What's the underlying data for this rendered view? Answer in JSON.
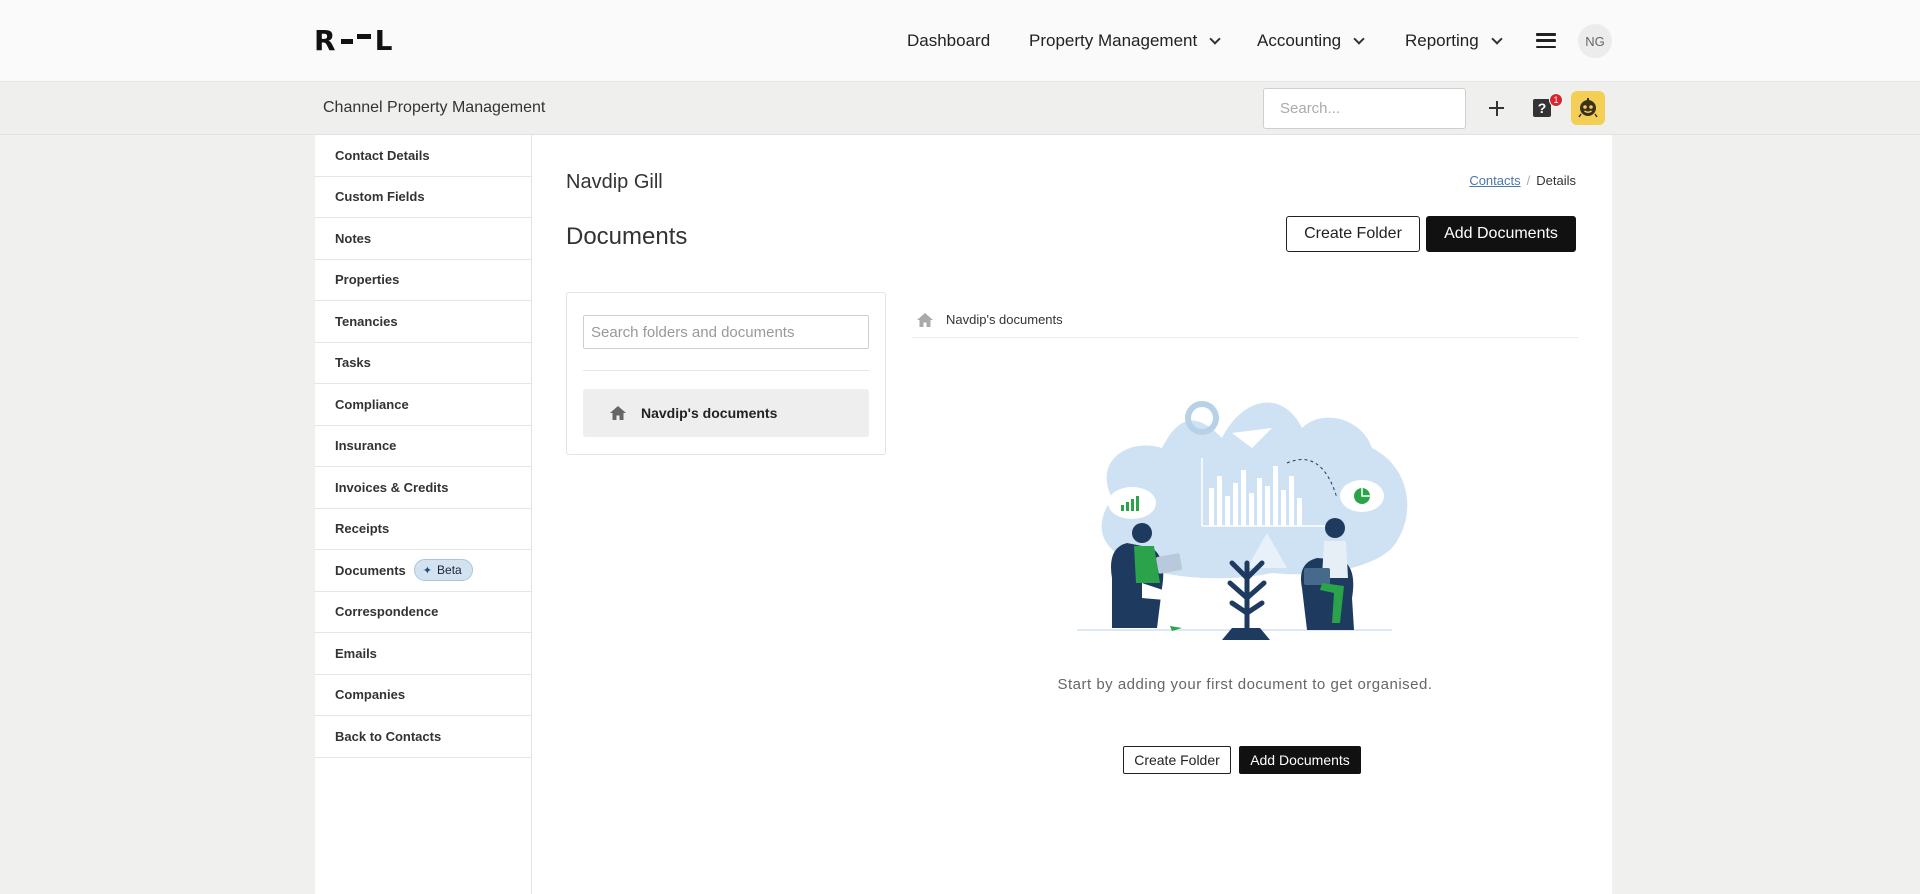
{
  "brand": {
    "logo_left": "R",
    "logo_right": "L"
  },
  "topnav": {
    "items": [
      {
        "label": "Dashboard",
        "has_menu": false
      },
      {
        "label": "Property Management",
        "has_menu": true
      },
      {
        "label": "Accounting",
        "has_menu": true
      },
      {
        "label": "Reporting",
        "has_menu": true
      }
    ],
    "user_initials": "NG"
  },
  "subbar": {
    "company": "Channel Property Management",
    "search_placeholder": "Search...",
    "help_badge": "1"
  },
  "sidebar": {
    "items": [
      {
        "label": "Contact Details"
      },
      {
        "label": "Custom Fields"
      },
      {
        "label": "Notes"
      },
      {
        "label": "Properties"
      },
      {
        "label": "Tenancies"
      },
      {
        "label": "Tasks"
      },
      {
        "label": "Compliance"
      },
      {
        "label": "Insurance"
      },
      {
        "label": "Invoices & Credits"
      },
      {
        "label": "Receipts"
      },
      {
        "label": "Documents",
        "badge": "Beta"
      },
      {
        "label": "Correspondence"
      },
      {
        "label": "Emails"
      },
      {
        "label": "Companies"
      },
      {
        "label": "Back to Contacts"
      }
    ]
  },
  "main": {
    "contact_name": "Navdip Gill",
    "breadcrumb": {
      "link": "Contacts",
      "separator": "/",
      "current": "Details"
    },
    "section_title": "Documents",
    "create_folder_label": "Create Folder",
    "add_documents_label": "Add Documents",
    "folder_search_placeholder": "Search folders and documents",
    "root_folder": "Navdip's documents",
    "current_path": "Navdip's documents",
    "empty_message": "Start by adding your first document to get organised."
  },
  "colors": {
    "accent_dark": "#111111",
    "link": "#4a78a8",
    "beta_badge_bg": "#d2e3ef",
    "illustration_blue": "#cfe2f3",
    "illustration_navy": "#1e3a5f",
    "illustration_green": "#2aa34a",
    "bot_icon_bg": "#f3cf55"
  },
  "icons": {
    "nav_menu": "hamburger-icon",
    "add": "plus-icon",
    "help": "help-icon",
    "assistant": "bot-icon",
    "folder_home": "home-icon"
  }
}
